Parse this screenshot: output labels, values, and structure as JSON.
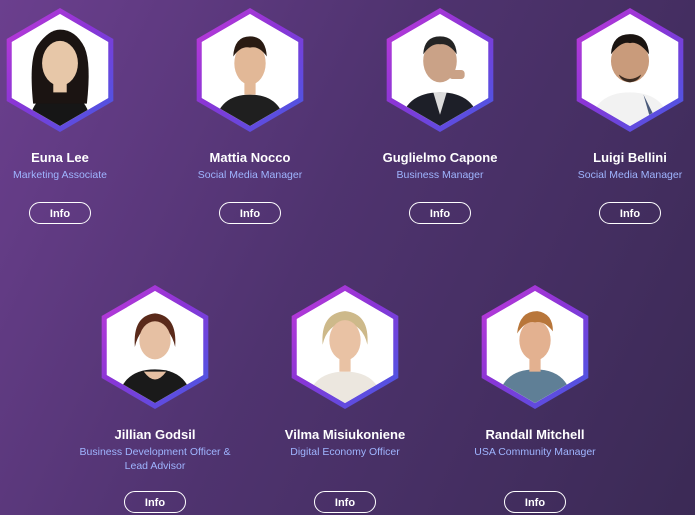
{
  "team": [
    {
      "name": "Euna Lee",
      "role": "Marketing Associate",
      "button": "Info",
      "skin": "#e7c7a8",
      "hair": "#1b1412",
      "shirt": "#161616"
    },
    {
      "name": "Mattia Nocco",
      "role": "Social Media Manager",
      "button": "Info",
      "skin": "#e2b897",
      "hair": "#2a1b12",
      "shirt": "#1f1f1f"
    },
    {
      "name": "Guglielmo Capone",
      "role": "Business Manager",
      "button": "Info",
      "skin": "#caa287",
      "hair": "#242424",
      "shirt": "#1d1f28"
    },
    {
      "name": "Luigi Bellini",
      "role": "Social Media Manager",
      "button": "Info",
      "skin": "#c99b7b",
      "hair": "#1a1411",
      "shirt": "#f2f2f2"
    },
    {
      "name": "Jillian Godsil",
      "role": "Business Development Officer & Lead Advisor",
      "button": "Info",
      "skin": "#e6c0a3",
      "hair": "#5a2a1a",
      "shirt": "#1a1a1a"
    },
    {
      "name": "Vilma Misiukoniene",
      "role": "Digital Economy Officer",
      "button": "Info",
      "skin": "#e9c2a4",
      "hair": "#cdb98a",
      "shirt": "#ece7df"
    },
    {
      "name": "Randall Mitchell",
      "role": "USA Community Manager",
      "button": "Info",
      "skin": "#e3b190",
      "hair": "#b8763a",
      "shirt": "#5f7f96"
    }
  ]
}
